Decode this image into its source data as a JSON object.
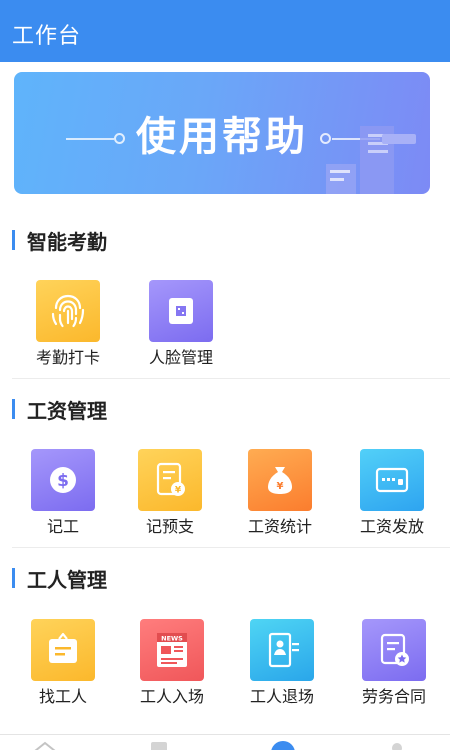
{
  "app": {
    "title": "工作台"
  },
  "banner": {
    "text": "使用帮助"
  },
  "sections": [
    {
      "title": "智能考勤",
      "items": [
        {
          "label": "考勤打卡",
          "icon": "fingerprint-icon",
          "color": "#fbb82c"
        },
        {
          "label": "人脸管理",
          "icon": "face-sim-icon",
          "color": "#7c6cf0"
        }
      ]
    },
    {
      "title": "工资管理",
      "items": [
        {
          "label": "记工",
          "icon": "dollar-icon",
          "color": "#7c6cf0"
        },
        {
          "label": "记预支",
          "icon": "advance-note-icon",
          "color": "#fbb82c"
        },
        {
          "label": "工资统计",
          "icon": "money-bag-icon",
          "color": "#fb7d2e"
        },
        {
          "label": "工资发放",
          "icon": "card-icon",
          "color": "#2ea4f0"
        }
      ]
    },
    {
      "title": "工人管理",
      "items": [
        {
          "label": "找工人",
          "icon": "sign-board-icon",
          "color": "#fbb82c"
        },
        {
          "label": "工人入场",
          "icon": "news-icon",
          "color": "#f0575a"
        },
        {
          "label": "工人退场",
          "icon": "badge-icon",
          "color": "#2aa6ea"
        },
        {
          "label": "劳务合同",
          "icon": "contract-icon",
          "color": "#7c6cf0"
        }
      ]
    }
  ],
  "colors": {
    "accent": "#3b8cf0",
    "background": "#ffffff"
  }
}
